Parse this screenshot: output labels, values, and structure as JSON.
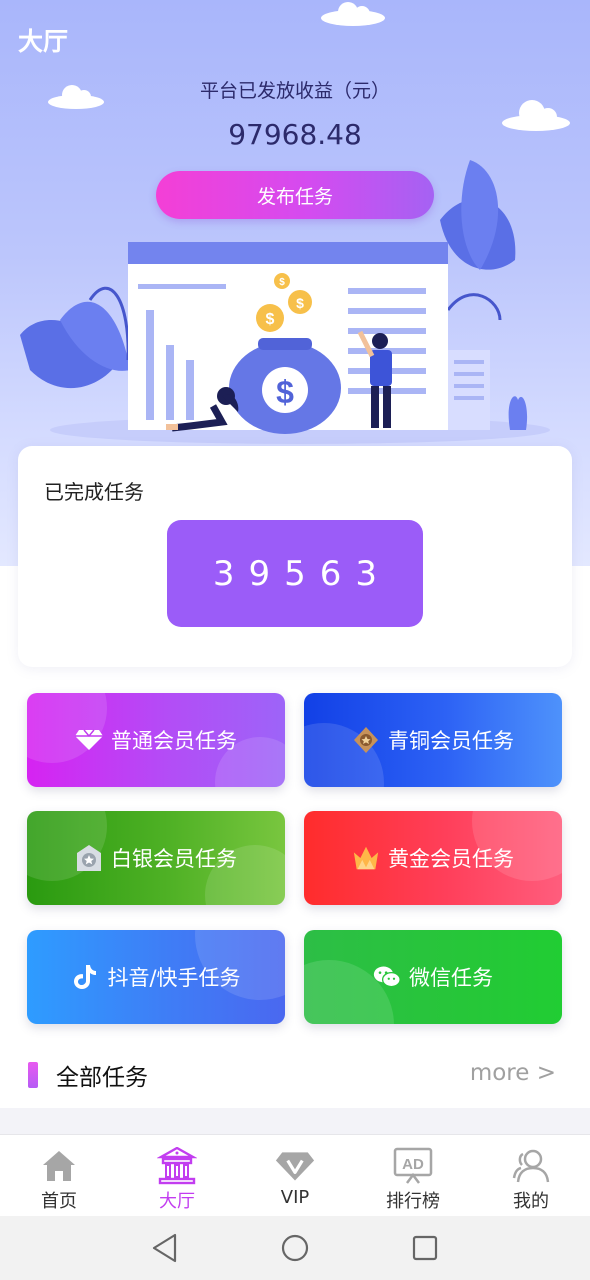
{
  "header": {
    "title": "大厅"
  },
  "income": {
    "label": "平台已发放收益（元）",
    "value": "97968.48"
  },
  "publish_button": {
    "label": "发布任务"
  },
  "completed": {
    "title": "已完成任务",
    "count": "39563"
  },
  "task_tiles": [
    {
      "label": "普通会员任务",
      "icon": "diamond-icon"
    },
    {
      "label": "青铜会员任务",
      "icon": "bronze-badge-icon"
    },
    {
      "label": "白银会员任务",
      "icon": "silver-badge-icon"
    },
    {
      "label": "黄金会员任务",
      "icon": "gold-crown-icon"
    },
    {
      "label": "抖音/快手任务",
      "icon": "tiktok-icon"
    },
    {
      "label": "微信任务",
      "icon": "wechat-icon"
    }
  ],
  "all_tasks": {
    "title": "全部任务",
    "more": "more >"
  },
  "tabbar": {
    "items": [
      {
        "label": "首页",
        "icon": "home-icon",
        "active": false
      },
      {
        "label": "大厅",
        "icon": "hall-icon",
        "active": true
      },
      {
        "label": "VIP",
        "icon": "vip-icon",
        "active": false
      },
      {
        "label": "排行榜",
        "icon": "ad-board-icon",
        "active": false
      },
      {
        "label": "我的",
        "icon": "user-icon",
        "active": false
      }
    ]
  },
  "colors": {
    "accent": "#c23df0",
    "counter_bg": "#9b5cf8",
    "hero_top": "#a9b6fb",
    "text_dark": "#2c2a6b"
  }
}
